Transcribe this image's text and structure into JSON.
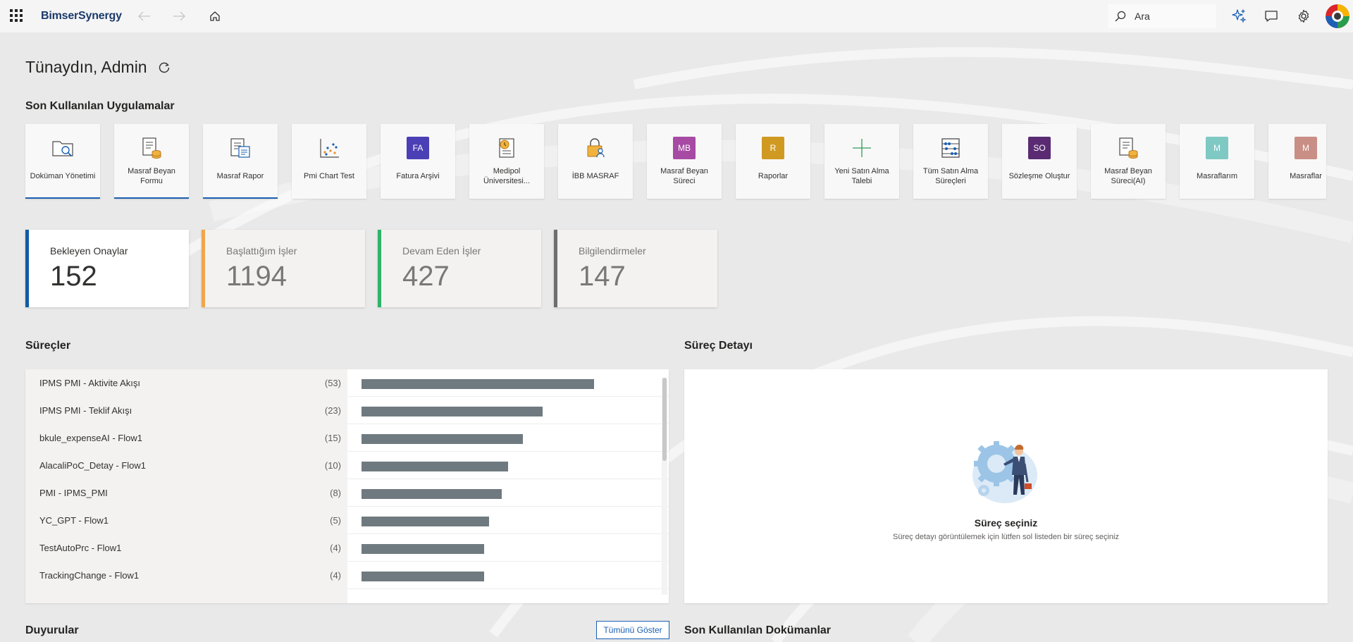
{
  "header": {
    "brand": "BimserSynergy",
    "search_placeholder": "Ara"
  },
  "greeting": "Tünaydın, Admin",
  "recent_apps": {
    "title": "Son Kullanılan Uygulamalar",
    "items": [
      {
        "label": "Doküman Yönetimi",
        "icon": "folder-search-icon",
        "active": true
      },
      {
        "label": "Masraf Beyan Formu",
        "icon": "form-coins-icon",
        "active": true
      },
      {
        "label": "Masraf Rapor",
        "icon": "report-icon",
        "active": true
      },
      {
        "label": "Pmi Chart Test",
        "icon": "chart-icon",
        "active": false
      },
      {
        "label": "Fatura Arşivi",
        "icon": "initials-tile",
        "initials": "FA",
        "color": "#4b3fb5",
        "active": false
      },
      {
        "label": "Medipol Üniversitesi...",
        "icon": "doc-clock-icon",
        "active": false
      },
      {
        "label": "İBB MASRAF",
        "icon": "lock-user-icon",
        "active": false
      },
      {
        "label": "Masraf Beyan Süreci",
        "icon": "initials-tile",
        "initials": "MB",
        "color": "#a74aa4",
        "active": false
      },
      {
        "label": "Raporlar",
        "icon": "initials-tile",
        "initials": "R",
        "color": "#d09a22",
        "active": false
      },
      {
        "label": "Yeni Satın Alma Talebi",
        "icon": "plus-icon",
        "active": false
      },
      {
        "label": "Tüm Satın Alma Süreçleri",
        "icon": "abacus-icon",
        "active": false
      },
      {
        "label": "Sözleşme Oluştur",
        "icon": "initials-tile",
        "initials": "SO",
        "color": "#5a2b73",
        "active": false
      },
      {
        "label": "Masraf Beyan Süreci(AI)",
        "icon": "form-coins-icon",
        "active": false
      },
      {
        "label": "Masraflarım",
        "icon": "initials-tile",
        "initials": "M",
        "color": "#7ec9c4",
        "active": false
      },
      {
        "label": "Masraflar",
        "icon": "initials-tile",
        "initials": "M",
        "color": "#c98e85",
        "active": false
      }
    ]
  },
  "stats": [
    {
      "title": "Bekleyen Onaylar",
      "value": "152",
      "color": "#0f5ba8"
    },
    {
      "title": "Başlattığım İşler",
      "value": "1194",
      "color": "#f2a54a"
    },
    {
      "title": "Devam Eden İşler",
      "value": "427",
      "color": "#2eb36a"
    },
    {
      "title": "Bilgilendirmeler",
      "value": "147",
      "color": "#6f6f6f"
    }
  ],
  "processes": {
    "title": "Süreçler",
    "items": [
      {
        "name": "IPMS PMI - Aktivite Akışı",
        "count": "(53)",
        "value": 53
      },
      {
        "name": "IPMS PMI - Teklif Akışı",
        "count": "(23)",
        "value": 23
      },
      {
        "name": "bkule_expenseAI - Flow1",
        "count": "(15)",
        "value": 15
      },
      {
        "name": "AlacaliPoC_Detay - Flow1",
        "count": "(10)",
        "value": 10
      },
      {
        "name": "PMI - IPMS_PMI",
        "count": "(8)",
        "value": 8
      },
      {
        "name": "YC_GPT - Flow1",
        "count": "(5)",
        "value": 5
      },
      {
        "name": "TestAutoPrc - Flow1",
        "count": "(4)",
        "value": 4
      },
      {
        "name": "TrackingChange - Flow1",
        "count": "(4)",
        "value": 4
      }
    ]
  },
  "detail": {
    "title": "Süreç Detayı",
    "empty_title": "Süreç seçiniz",
    "empty_sub": "Süreç detayı görüntülemek için lütfen sol listeden bir süreç seçiniz"
  },
  "bottom": {
    "announcements": "Duyurular",
    "show_all": "Tümünü Göster",
    "recent_docs": "Son Kullanılan Dokümanlar"
  }
}
